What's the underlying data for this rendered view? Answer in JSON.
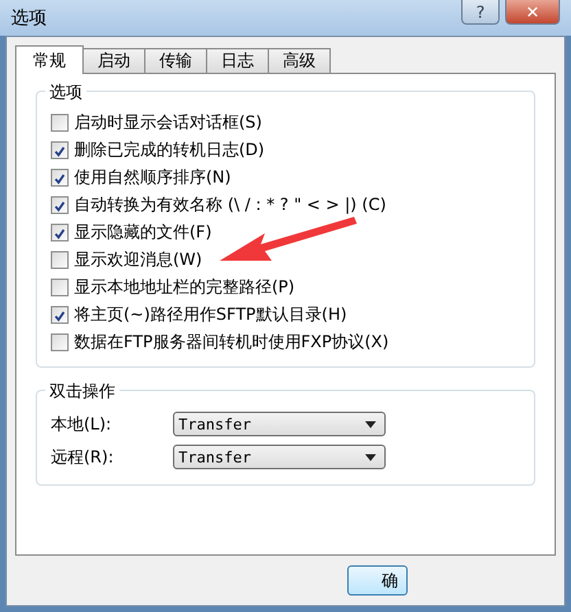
{
  "window": {
    "title": "选项",
    "help": "?",
    "close": "✕"
  },
  "tabs": [
    {
      "label": "常规",
      "selected": true
    },
    {
      "label": "启动",
      "selected": false
    },
    {
      "label": "传输",
      "selected": false
    },
    {
      "label": "日志",
      "selected": false
    },
    {
      "label": "高级",
      "selected": false
    }
  ],
  "options_group": {
    "title": "选项",
    "items": [
      {
        "label": "启动时显示会话对话框(S)",
        "checked": false
      },
      {
        "label": "删除已完成的转机日志(D)",
        "checked": true
      },
      {
        "label": "使用自然顺序排序(N)",
        "checked": true
      },
      {
        "label": "自动转换为有效名称 (\\ / : * ? \" < > |) (C)",
        "checked": true
      },
      {
        "label": "显示隐藏的文件(F)",
        "checked": true
      },
      {
        "label": "显示欢迎消息(W)",
        "checked": false
      },
      {
        "label": "显示本地地址栏的完整路径(P)",
        "checked": false
      },
      {
        "label": "将主页(~)路径用作SFTP默认目录(H)",
        "checked": true
      },
      {
        "label": "数据在FTP服务器间转机时使用FXP协议(X)",
        "checked": false
      }
    ]
  },
  "double_click_group": {
    "title": "双击操作",
    "rows": [
      {
        "label": "本地(L):",
        "value": "Transfer"
      },
      {
        "label": "远程(R):",
        "value": "Transfer"
      }
    ]
  },
  "buttons": [
    "确"
  ]
}
